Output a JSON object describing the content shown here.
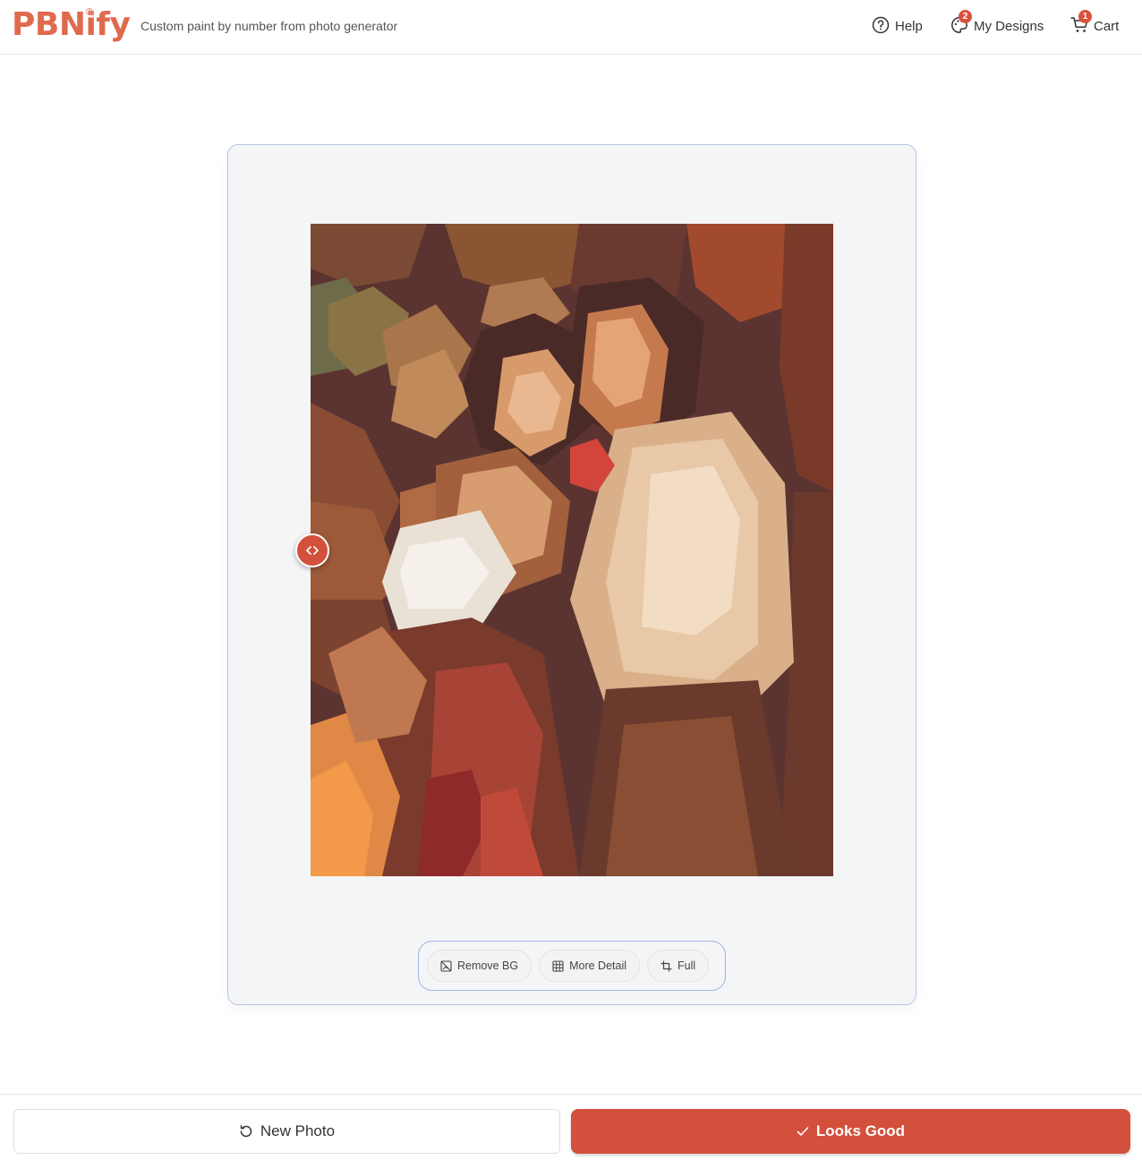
{
  "header": {
    "logo": "PBNify",
    "logo_mark": "®",
    "tagline": "Custom paint by number from photo generator",
    "nav": {
      "help": {
        "label": "Help",
        "icon": "question-circle-icon"
      },
      "designs": {
        "label": "My Designs",
        "icon": "palette-icon",
        "badge": "2"
      },
      "cart": {
        "label": "Cart",
        "icon": "cart-icon",
        "badge": "1"
      }
    }
  },
  "editor": {
    "image": "paint-by-number preview of a family photo",
    "compare_handle_icon": "code-arrows-icon",
    "toolbar": {
      "remove_bg": "Remove BG",
      "more_detail": "More Detail",
      "full": "Full"
    }
  },
  "footer": {
    "new_photo": "New Photo",
    "looks_good": "Looks Good"
  },
  "colors": {
    "brand": "#e06a4d",
    "accent": "#d2503c",
    "card_border": "#b7c6e8"
  }
}
